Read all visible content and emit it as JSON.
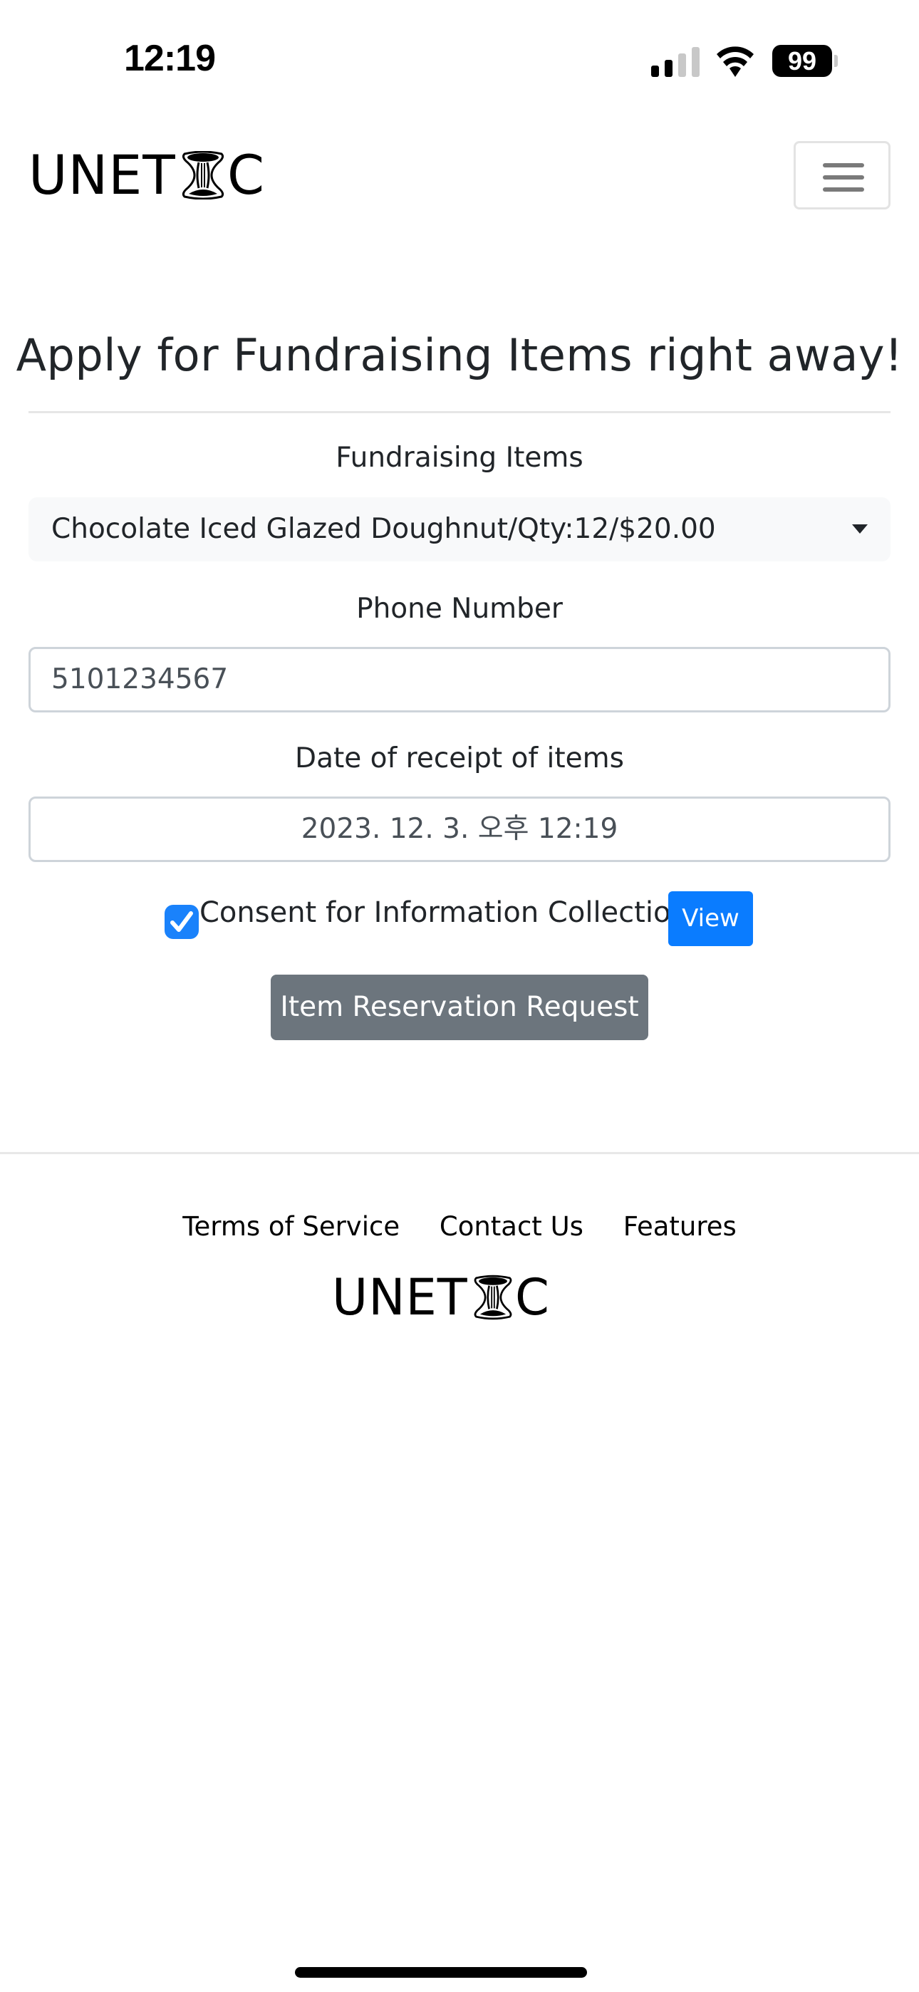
{
  "status_bar": {
    "time": "12:19",
    "battery_level": "99",
    "signal_bars_active": 2,
    "signal_bars_total": 4,
    "icons": [
      "signal-icon",
      "wifi-icon",
      "battery-icon"
    ]
  },
  "navbar": {
    "logo_text_left": "UNET",
    "logo_text_right": "C",
    "menu_icon": "hamburger-menu-icon"
  },
  "main": {
    "title": "Apply for Fundraising Items right away!",
    "fundraising_items": {
      "label": "Fundraising Items",
      "selected": "Chocolate Iced Glazed Doughnut/Qty:12/$20.00"
    },
    "phone": {
      "label": "Phone Number",
      "value": "5101234567"
    },
    "date": {
      "label": "Date of receipt of items",
      "value": "2023. 12. 3. 오후 12:19"
    },
    "consent": {
      "checked": true,
      "label": "Consent for Information Collection",
      "view_button": "View"
    },
    "submit_button": "Item Reservation Request"
  },
  "footer": {
    "links": [
      "Terms of Service",
      "Contact Us",
      "Features"
    ],
    "logo_text_left": "UNET",
    "logo_text_right": "C"
  },
  "colors": {
    "primary": "#0a7cff",
    "secondary": "#6c757d",
    "checkbox": "#1a82fb",
    "text": "#212529"
  }
}
